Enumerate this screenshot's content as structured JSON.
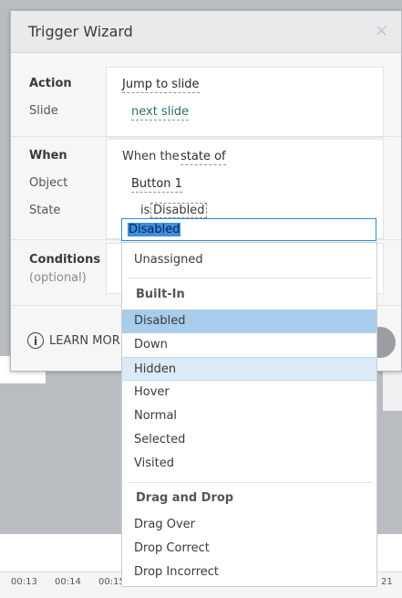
{
  "dialog": {
    "title": "Trigger Wizard",
    "close_icon": "×",
    "action": {
      "label": "Action",
      "slide_label": "Slide",
      "action_value": "Jump to slide",
      "slide_value": "next slide"
    },
    "when": {
      "label": "When",
      "object_label": "Object",
      "state_label": "State",
      "sentence_prefix": "When the",
      "sentence_link": "state of",
      "object_value": "Button 1",
      "state_prefix": "is",
      "state_value": "Disabled"
    },
    "conditions": {
      "label": "Conditions",
      "sublabel": "(optional)"
    },
    "learn_more": "LEARN MORE",
    "info_icon": "i"
  },
  "dropdown": {
    "input_value": "Disabled",
    "unassigned": "Unassigned",
    "groups": [
      {
        "header": "Built-In",
        "items": [
          "Disabled",
          "Down",
          "Hidden",
          "Hover",
          "Normal",
          "Selected",
          "Visited"
        ]
      },
      {
        "header": "Drag and Drop",
        "items": [
          "Drag Over",
          "Drop Correct",
          "Drop Incorrect"
        ]
      }
    ],
    "selected": "Disabled",
    "hovered": "Hidden"
  },
  "timeline": {
    "ticks": [
      "00:13",
      "00:14",
      "00:15",
      "21"
    ]
  },
  "colors": {
    "accent": "#2e8bd6",
    "selected_bg": "#a8cdec",
    "hover_bg": "#dbeaf6",
    "link_teal": "#27706e"
  }
}
